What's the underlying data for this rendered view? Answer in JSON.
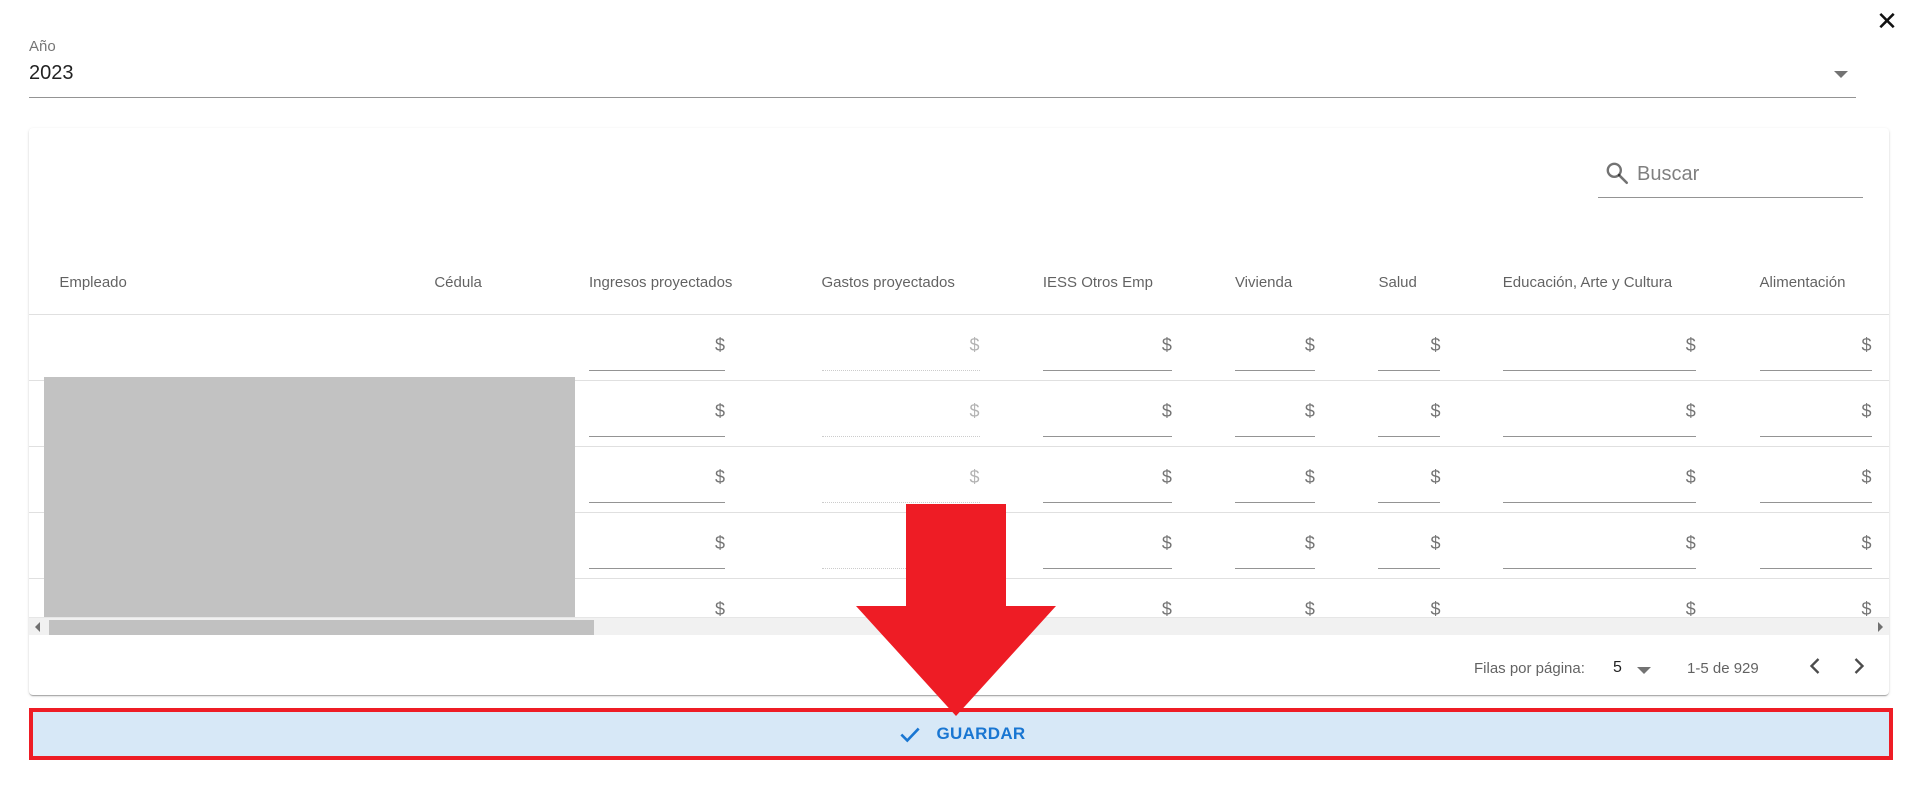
{
  "dialog": {
    "close_icon": "close-icon",
    "close_glyph": "✕"
  },
  "year": {
    "label": "Año",
    "value": "2023"
  },
  "search": {
    "placeholder": "Buscar",
    "value": ""
  },
  "table": {
    "columns": [
      "Empleado",
      "Cédula",
      "Ingresos proyectados",
      "Gastos proyectados",
      "IESS Otros Emp",
      "Vivienda",
      "Salud",
      "Educación, Arte y Cultura",
      "Alimentación"
    ],
    "currency_symbol": "$",
    "row_count": 5,
    "redacted_columns": [
      "Empleado",
      "Cédula"
    ]
  },
  "pagination": {
    "rows_per_page_label": "Filas por página:",
    "rows_per_page_value": "5",
    "range_text": "1-5 de 929"
  },
  "save_button": {
    "label": "GUARDAR",
    "icon": "check-icon"
  },
  "colors": {
    "accent": "#1976d2",
    "save_bg": "#d7e8f7",
    "highlight_red": "#ee1c25",
    "redaction_gray": "#c2c2c2"
  }
}
